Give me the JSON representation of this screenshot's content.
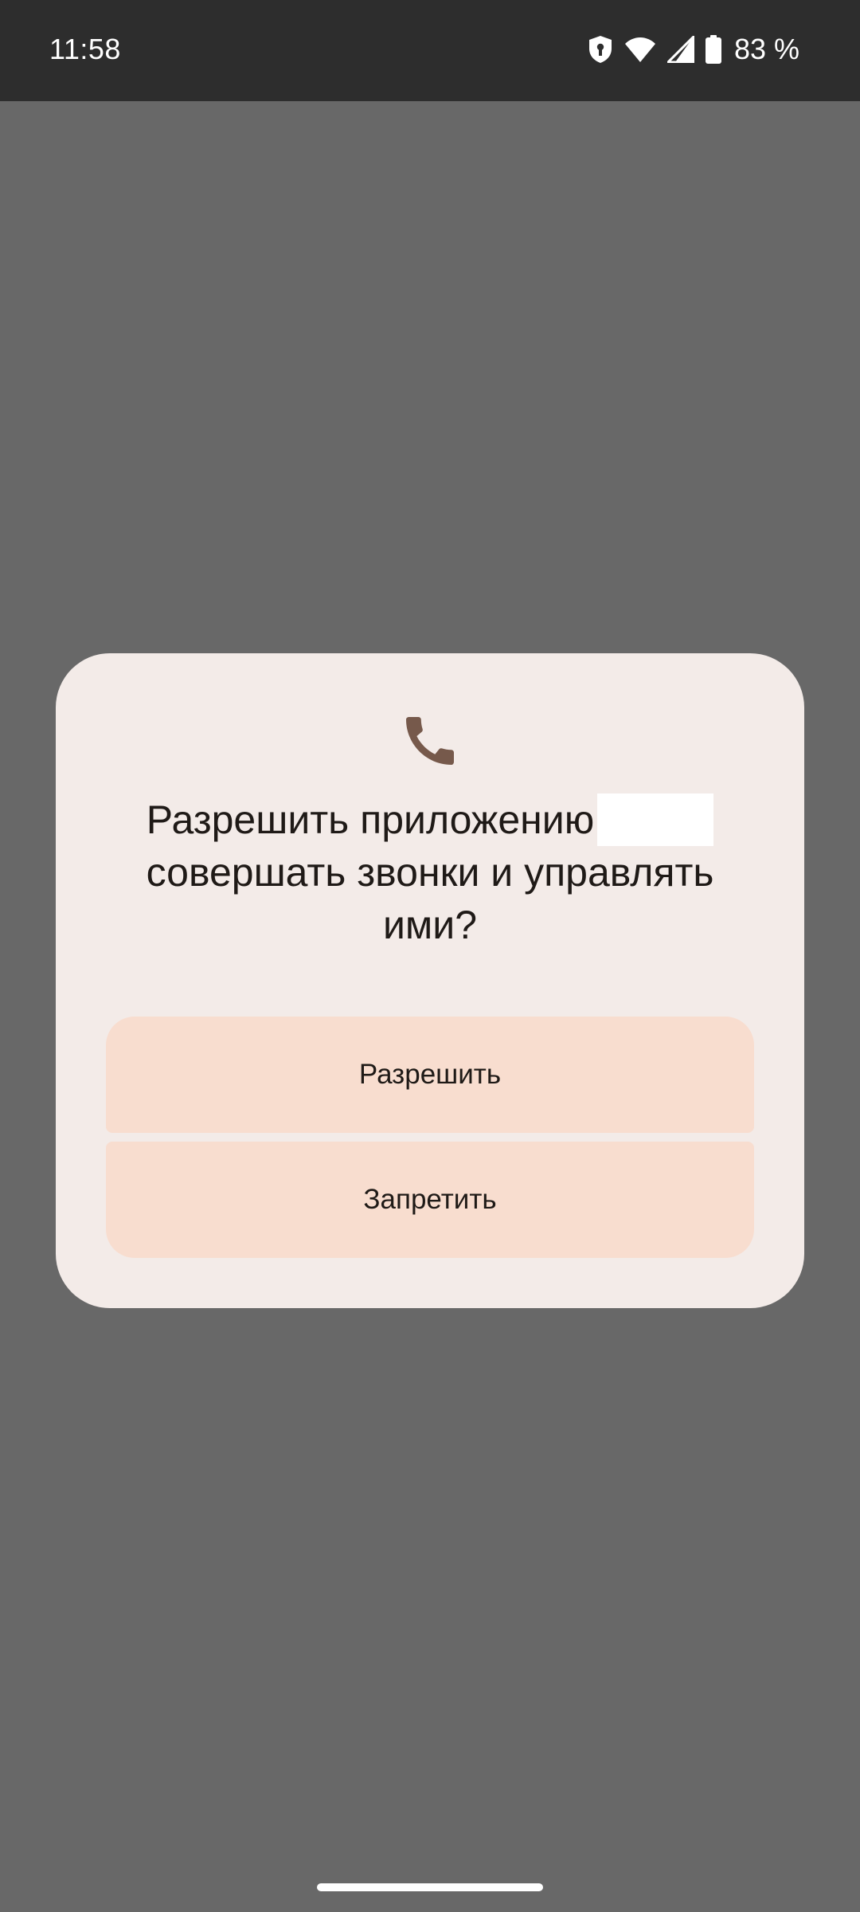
{
  "status_bar": {
    "time": "11:58",
    "battery_text": "83 %",
    "icons": [
      "shield-icon",
      "wifi-icon",
      "cell-signal-icon",
      "battery-icon"
    ]
  },
  "dialog": {
    "icon": "phone-icon",
    "title_line_1": "Разрешить приложению",
    "title_rest": "совершать звонки и управлять ими?",
    "allow_label": "Разрешить",
    "deny_label": "Запретить"
  },
  "colors": {
    "scrim": "#686868",
    "status_bar": "#2d2d2d",
    "dialog_bg": "#f3ebe8",
    "button_bg": "#f8ddcf",
    "icon_color": "#76594b",
    "text": "#1f1a17"
  }
}
